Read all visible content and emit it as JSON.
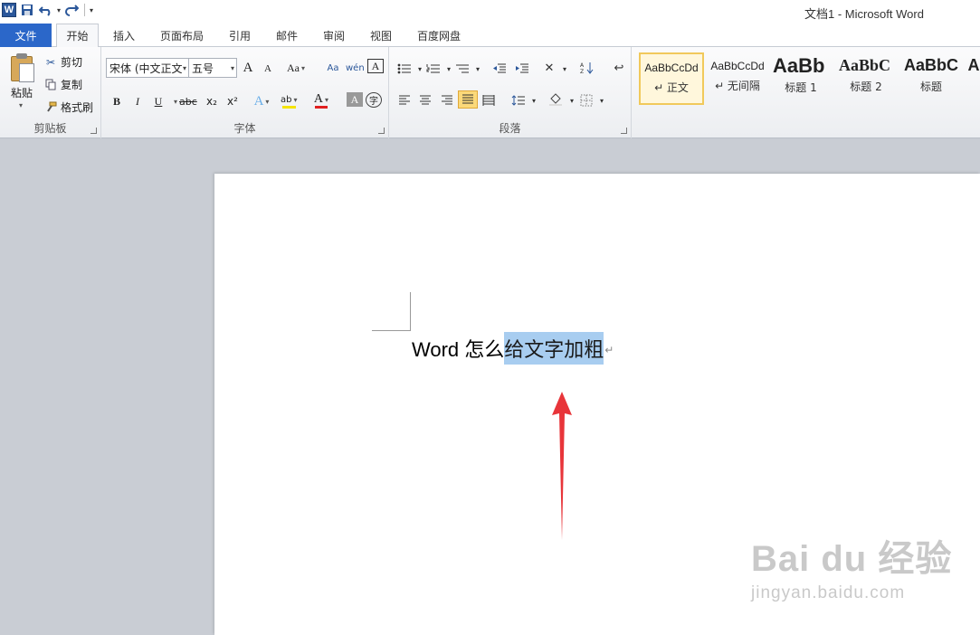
{
  "window": {
    "title": "文档1 - Microsoft Word",
    "app_logo": "W"
  },
  "qat": {
    "icons": [
      "word-logo-icon",
      "save-icon",
      "undo-icon",
      "redo-icon",
      "customize-qat-icon"
    ]
  },
  "tabs": [
    {
      "id": "file",
      "label": "文件",
      "active": false
    },
    {
      "id": "home",
      "label": "开始",
      "active": true
    },
    {
      "id": "insert",
      "label": "插入",
      "active": false
    },
    {
      "id": "layout",
      "label": "页面布局",
      "active": false
    },
    {
      "id": "references",
      "label": "引用",
      "active": false
    },
    {
      "id": "mailings",
      "label": "邮件",
      "active": false
    },
    {
      "id": "review",
      "label": "审阅",
      "active": false
    },
    {
      "id": "view",
      "label": "视图",
      "active": false
    },
    {
      "id": "baidu",
      "label": "百度网盘",
      "active": false
    }
  ],
  "clipboard": {
    "group_label": "剪贴板",
    "paste_label": "粘贴",
    "cut_label": "剪切",
    "copy_label": "复制",
    "format_painter_label": "格式刷"
  },
  "font": {
    "group_label": "字体",
    "font_name": "宋体 (中文正文",
    "font_size": "五号",
    "grow_label": "A",
    "shrink_label": "A",
    "case_label": "Aa",
    "bold_label": "B",
    "italic_label": "I",
    "underline_label": "U",
    "strike_label": "abc",
    "subscript_label": "x₂",
    "superscript_label": "x²",
    "font_color_label": "A",
    "shading_label": "A",
    "encircle_label": "字",
    "highlight_color": "#f5e400",
    "font_color": "#e02020"
  },
  "paragraph": {
    "group_label": "段落"
  },
  "styles": {
    "items": [
      {
        "sample": "AaBbCcDd",
        "name": "↵ 正文",
        "selected": true
      },
      {
        "sample": "AaBbCcDd",
        "name": "↵ 无间隔",
        "selected": false
      },
      {
        "sample": "AaBb",
        "name": "标题 1",
        "selected": false
      },
      {
        "sample": "AaBbC",
        "name": "标题 2",
        "selected": false
      },
      {
        "sample": "AaBbC",
        "name": "标题",
        "selected": false
      },
      {
        "sample": "A",
        "name": "",
        "selected": false
      }
    ]
  },
  "document": {
    "text_plain": "Word 怎么",
    "text_selected": "给文字加粗",
    "pilcrow": "↵",
    "selection_color": "#a8cdf0"
  },
  "annotation": {
    "arrow_color": "#e8353a"
  },
  "watermark": {
    "main": "Bai du 经验",
    "sub": "jingyan.baidu.com"
  }
}
